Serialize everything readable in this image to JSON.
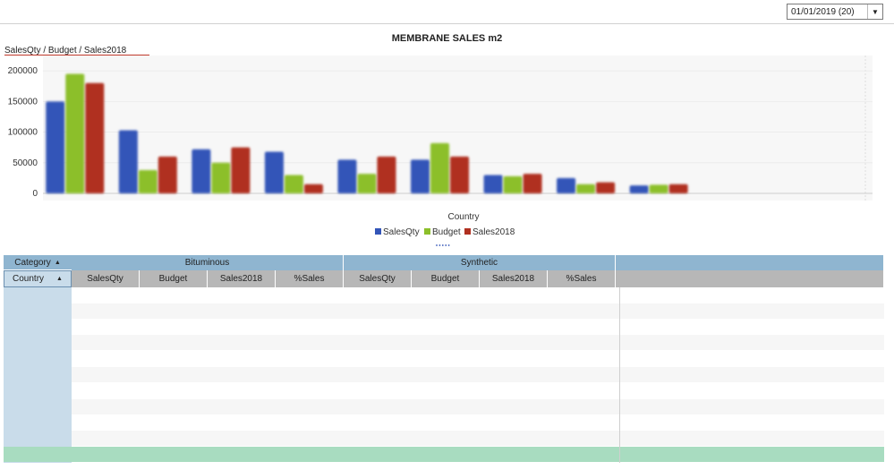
{
  "date_filter": {
    "value": "01/01/2019 (20)"
  },
  "icons": {
    "dropdown": "chevron-down-icon",
    "sort": "sort-up-icon"
  },
  "chart_data": {
    "type": "bar",
    "title": "MEMBRANE SALES m2",
    "ylabel": "SalesQty / Budget / Sales2018",
    "xlabel": "Country",
    "ylim": [
      0,
      225000
    ],
    "yticks": [
      "200000",
      "150000",
      "100000",
      "50000",
      "0"
    ],
    "ytick_values": [
      200000,
      150000,
      100000,
      50000,
      0
    ],
    "categories": [
      "",
      "",
      "",
      "",
      "",
      "",
      "",
      "",
      "",
      "",
      ""
    ],
    "series": [
      {
        "name": "SalesQty",
        "color": "#3355b8",
        "values": [
          150000,
          103000,
          72000,
          68000,
          55000,
          55000,
          30000,
          25000,
          13000,
          0,
          0
        ]
      },
      {
        "name": "Budget",
        "color": "#8cbf2a",
        "values": [
          195000,
          38000,
          50000,
          30000,
          32000,
          82000,
          28000,
          15000,
          14000,
          0,
          0
        ]
      },
      {
        "name": "Sales2018",
        "color": "#b03020",
        "values": [
          180000,
          60000,
          75000,
          15000,
          60000,
          60000,
          32000,
          18000,
          15000,
          0,
          0
        ]
      }
    ],
    "legend_position": "bottom"
  },
  "pivot": {
    "category_label": "Category",
    "country_label": "Country",
    "groups": [
      "Bituminous",
      "Synthetic"
    ],
    "columns": [
      "SalesQty",
      "Budget",
      "Sales2018",
      "%Sales",
      "SalesQty",
      "Budget",
      "Sales2018",
      "%Sales"
    ]
  }
}
